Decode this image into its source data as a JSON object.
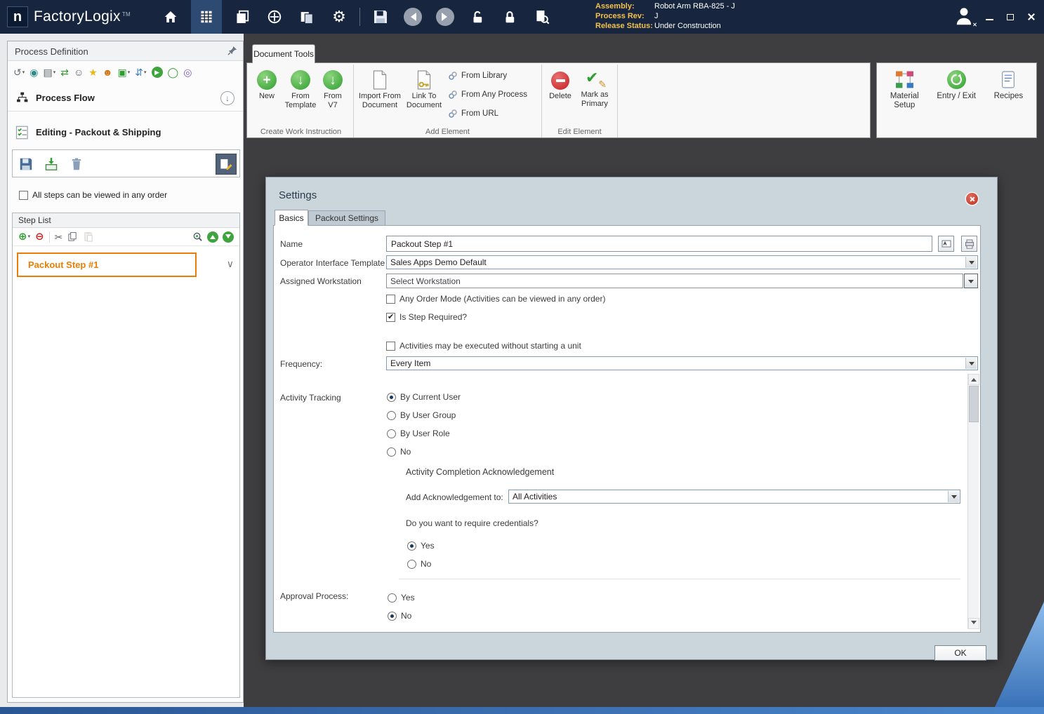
{
  "colors": {
    "titlebar": "#17263e",
    "accent_orange": "#e87e04",
    "dialog_bg": "#cbd5dc",
    "main_bg": "#3e3e40",
    "bottom_bar": "#2a5694"
  },
  "titlebar": {
    "logo_letter": "n",
    "app_name": "FactoryLogix",
    "trademark": "TM",
    "assembly_label": "Assembly:",
    "assembly_value": "Robot Arm RBA-825 - J",
    "process_rev_label": "Process Rev:",
    "process_rev_value": "J",
    "release_status_label": "Release Status:",
    "release_status_value": "Under Construction"
  },
  "left_panel": {
    "title": "Process Definition",
    "process_flow": "Process Flow",
    "editing": "Editing - Packout & Shipping",
    "any_order": "All steps can be viewed in any order",
    "step_list": {
      "title": "Step List",
      "steps": [
        {
          "label": "Packout Step #1"
        }
      ]
    }
  },
  "ribbon": {
    "tab": "Document Tools",
    "create_group": {
      "label": "Create Work Instruction",
      "new": "New",
      "from_template": "From\nTemplate",
      "from_v7": "From\nV7"
    },
    "add_group": {
      "label": "Add Element",
      "import": "Import From\nDocument",
      "link": "Link To\nDocument",
      "from_library": "From Library",
      "from_any_process": "From Any Process",
      "from_url": "From URL"
    },
    "edit_group": {
      "label": "Edit Element",
      "delete": "Delete",
      "mark_primary": "Mark as\nPrimary"
    },
    "right_items": {
      "material_setup": "Material\nSetup",
      "entry_exit": "Entry / Exit",
      "recipes": "Recipes"
    }
  },
  "dialog": {
    "title": "Settings",
    "tabs": {
      "basics": "Basics",
      "packout": "Packout Settings"
    },
    "name_label": "Name",
    "name_value": "Packout Step #1",
    "template_label": "Operator Interface Template",
    "template_value": "Sales Apps Demo Default",
    "workstation_label": "Assigned Workstation",
    "workstation_value": "Select Workstation",
    "checkbox_any_order": "Any Order Mode (Activities can be viewed in any order)",
    "checkbox_any_order_checked": false,
    "checkbox_required": "Is Step Required?",
    "checkbox_required_checked": true,
    "checkbox_no_unit": "Activities may be executed without starting a unit",
    "checkbox_no_unit_checked": false,
    "frequency_label": "Frequency:",
    "frequency_value": "Every Item",
    "tracking_label": "Activity Tracking",
    "tracking_options": [
      "By Current User",
      "By User Group",
      "By User Role",
      "No"
    ],
    "tracking_selected": "By Current User",
    "ack_heading": "Activity Completion Acknowledgement",
    "ack_label": "Add Acknowledgement to:",
    "ack_value": "All Activities",
    "credentials_question": "Do you want to require credentials?",
    "credentials_yes": "Yes",
    "credentials_no": "No",
    "credentials_selected": "Yes",
    "approval_label": "Approval Process:",
    "approval_yes": "Yes",
    "approval_no": "No",
    "approval_selected": "No",
    "ok": "OK"
  }
}
